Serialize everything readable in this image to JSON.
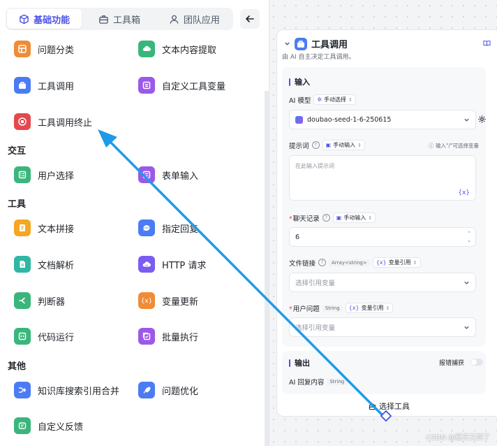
{
  "left_panel": {
    "tabs": [
      {
        "label": "基础功能",
        "icon": "cube-icon",
        "active": true
      },
      {
        "label": "工具箱",
        "icon": "toolbox-icon",
        "active": false
      },
      {
        "label": "团队应用",
        "icon": "user-icon",
        "active": false
      }
    ],
    "back_icon": "arrow-left-icon",
    "nodes_top": [
      {
        "label": "问题分类",
        "color": "#f08c36",
        "icon": "layout-icon"
      },
      {
        "label": "文本内容提取",
        "color": "#3ab67c",
        "icon": "cloud-icon"
      },
      {
        "label": "工具调用",
        "color": "#4b7cf3",
        "icon": "briefcase-icon"
      },
      {
        "label": "自定义工具变量",
        "color": "#9b59e8",
        "icon": "variable-icon"
      },
      {
        "label": "工具调用终止",
        "color": "#e5484d",
        "icon": "stop-icon"
      }
    ],
    "sections": [
      {
        "title": "交互",
        "nodes": [
          {
            "label": "用户选择",
            "color": "#3ab67c",
            "icon": "list-icon"
          },
          {
            "label": "表单输入",
            "color": "#9b59e8",
            "icon": "form-icon"
          }
        ]
      },
      {
        "title": "工具",
        "nodes": [
          {
            "label": "文本拼接",
            "color": "#f5a623",
            "icon": "doc-icon"
          },
          {
            "label": "指定回复",
            "color": "#4b7cf3",
            "icon": "chat-icon"
          },
          {
            "label": "文档解析",
            "color": "#2fb7a3",
            "icon": "file-icon"
          },
          {
            "label": "HTTP 请求",
            "color": "#7b5cf0",
            "icon": "cloud-api-icon"
          },
          {
            "label": "判断器",
            "color": "#3ab67c",
            "icon": "branch-icon"
          },
          {
            "label": "变量更新",
            "color": "#f08c36",
            "icon": "braces-icon"
          },
          {
            "label": "代码运行",
            "color": "#3ab67c",
            "icon": "code-icon"
          },
          {
            "label": "批量执行",
            "color": "#9b59e8",
            "icon": "batch-icon"
          }
        ]
      },
      {
        "title": "其他",
        "nodes": [
          {
            "label": "知识库搜索引用合并",
            "color": "#4b7cf3",
            "icon": "merge-icon"
          },
          {
            "label": "问题优化",
            "color": "#4b7cf3",
            "icon": "rocket-icon"
          },
          {
            "label": "自定义反馈",
            "color": "#3ab67c",
            "icon": "feedback-icon"
          }
        ]
      }
    ]
  },
  "card": {
    "title": "工具调用",
    "description": "由 AI 自主决定工具调用。",
    "input_section": {
      "title": "输入",
      "model_label": "AI 模型",
      "model_mode": "手动选择",
      "model_value": "doubao-seed-1-6-250615",
      "prompt_label": "提示词",
      "prompt_mode": "手动输入",
      "prompt_hint": "输入\"/\"可选择变量",
      "prompt_placeholder": "在此输入提示词",
      "history_label": "聊天记录",
      "history_mode": "手动输入",
      "history_value": "6",
      "file_label": "文件链接",
      "file_type": "Array<string>",
      "file_mode": "变量引用",
      "file_placeholder": "选择引用变量",
      "question_label": "用户问题",
      "question_type": "String",
      "question_mode": "变量引用",
      "question_placeholder": "选择引用变量"
    },
    "output_section": {
      "title": "输出",
      "error_capture_label": "报错捕获",
      "error_capture_on": false,
      "reply_label": "AI 回复内容",
      "reply_type": "String"
    },
    "select_tool_label": "选择工具"
  },
  "watermark": "CSDN @夏天又到了",
  "accent_color": "#4d53e8",
  "arrow_color": "#1e9be8"
}
